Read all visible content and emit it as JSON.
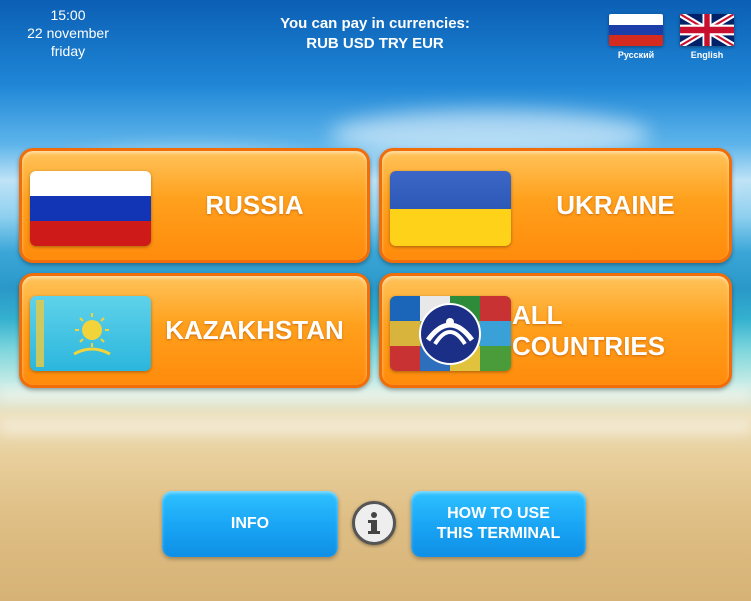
{
  "clock": {
    "time": "15:00",
    "date": "22 november",
    "weekday": "friday"
  },
  "currency": {
    "line1": "You can pay in currencies:",
    "line2": "RUB USD TRY EUR"
  },
  "languages": [
    {
      "label": "Русский",
      "flag": "russia-flag-icon"
    },
    {
      "label": "English",
      "flag": "uk-flag-icon"
    }
  ],
  "countries": [
    {
      "label": "RUSSIA",
      "flag": "russia-flag-icon"
    },
    {
      "label": "UKRAINE",
      "flag": "ukraine-flag-icon"
    },
    {
      "label": "KAZAKHSTAN",
      "flag": "kazakhstan-flag-icon"
    },
    {
      "label": "ALL COUNTRIES",
      "flag": "cis-flag-icon"
    }
  ],
  "footer": {
    "info_label": "INFO",
    "howto_line1": "HOW TO USE",
    "howto_line2": "THIS TERMINAL"
  },
  "colors": {
    "orange_button": "#ffa01c",
    "orange_border": "#f06d0a",
    "blue_button": "#1aa6f5"
  }
}
